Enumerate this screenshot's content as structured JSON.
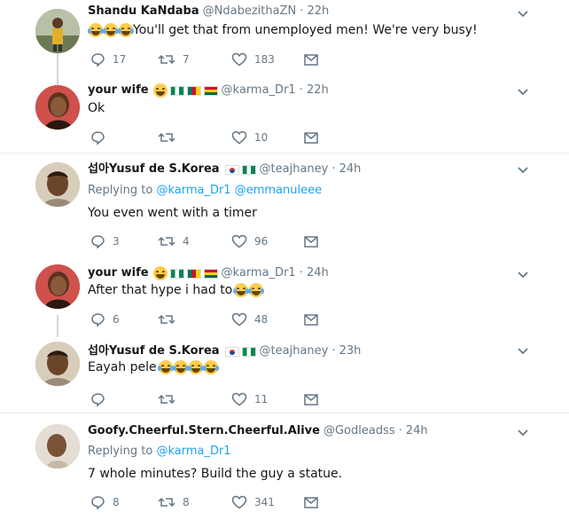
{
  "tweets": [
    {
      "name": "Shandu KaNdaba",
      "handle": "@NdabezithaZN",
      "time": "· 22h",
      "replying_label": "",
      "replying_to": [],
      "text": "You'll get that from unemployed men! We're very busy!",
      "replies": "17",
      "retweets": "7",
      "likes": "183",
      "avatar_color": "#8a9b7a"
    },
    {
      "name": "your wife",
      "handle": "@karma_Dr1",
      "time": "· 22h",
      "replying_label": "",
      "replying_to": [],
      "text": "Ok",
      "replies": "",
      "retweets": "",
      "likes": "10",
      "avatar_color": "#c44a4a"
    },
    {
      "name": "섭아Yusuf de S.Korea",
      "handle": "@teajhaney",
      "time": "· 24h",
      "replying_label": "Replying to",
      "replying_to": [
        "@karma_Dr1",
        "@emmanuleee"
      ],
      "text": "You even went with a timer",
      "replies": "3",
      "retweets": "4",
      "likes": "96",
      "avatar_color": "#b8a488"
    },
    {
      "name": "your wife",
      "handle": "@karma_Dr1",
      "time": "· 24h",
      "replying_label": "",
      "replying_to": [],
      "text": "After that hype i had to",
      "replies": "6",
      "retweets": "",
      "likes": "48",
      "avatar_color": "#c44a4a"
    },
    {
      "name": "섭아Yusuf de S.Korea",
      "handle": "@teajhaney",
      "time": "· 23h",
      "replying_label": "",
      "replying_to": [],
      "text": "Eayah pele",
      "replies": "",
      "retweets": "",
      "likes": "11",
      "avatar_color": "#b8a488"
    },
    {
      "name": "Goofy.Cheerful.Stern.Cheerful.Alive",
      "handle": "@Godleadss",
      "time": "· 24h",
      "replying_label": "Replying to",
      "replying_to": [
        "@karma_Dr1"
      ],
      "text": "7 whole minutes? Build the guy a statue.",
      "replies": "8",
      "retweets": "8",
      "likes": "341",
      "avatar_color": "#a89a8a"
    }
  ]
}
